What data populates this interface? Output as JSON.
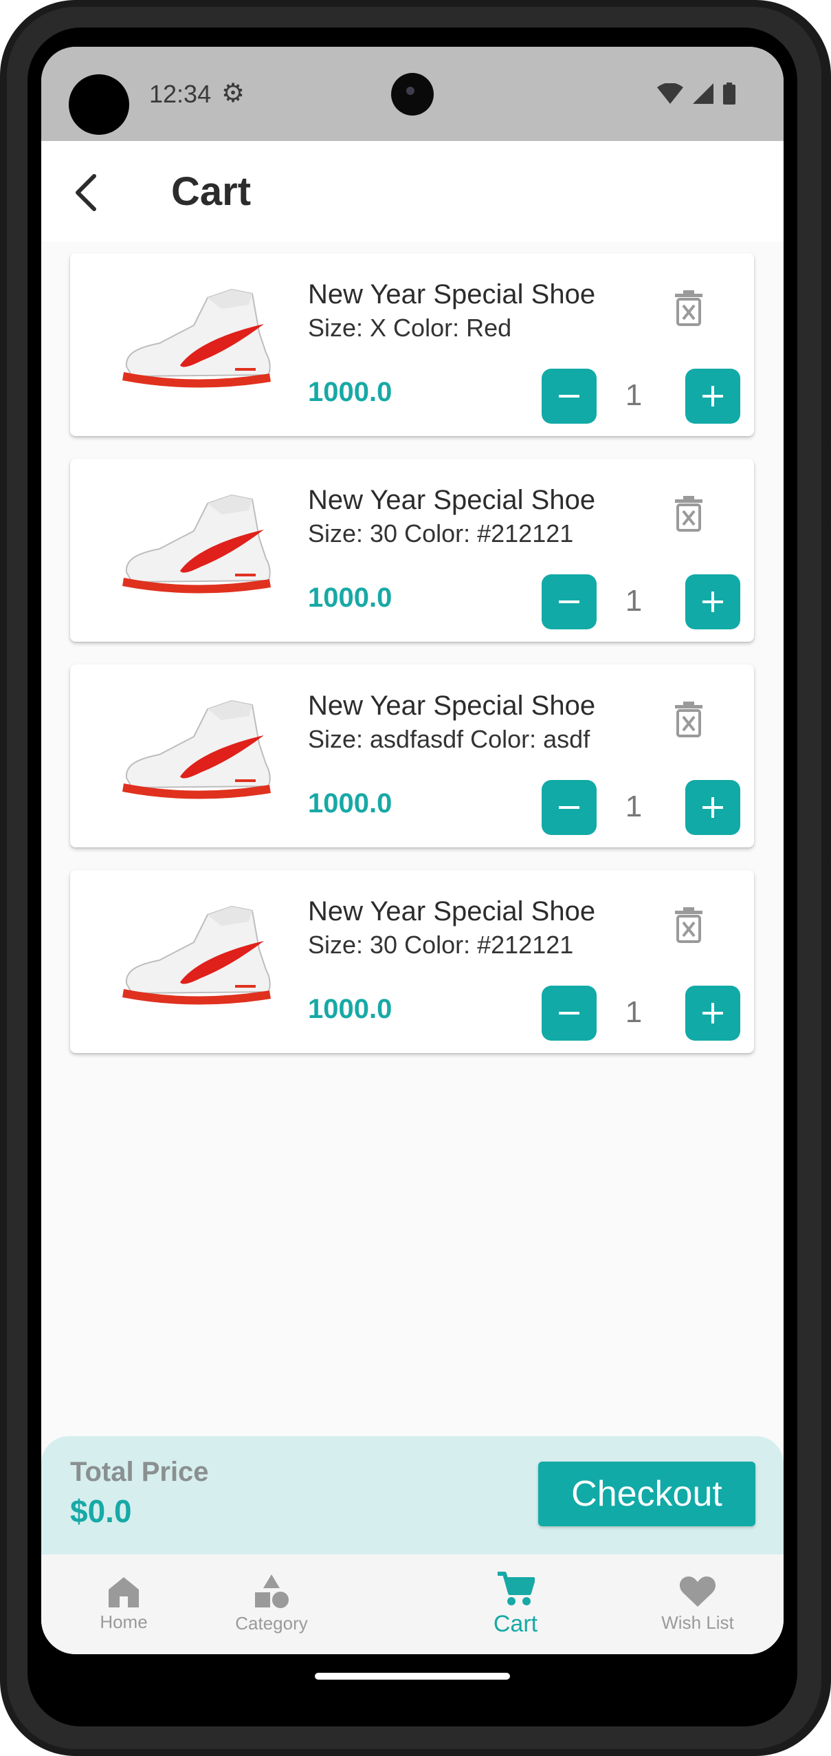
{
  "status_bar": {
    "time": "12:34"
  },
  "header": {
    "title": "Cart",
    "back_icon": "arrow-back-icon"
  },
  "cart_items": [
    {
      "name": "New Year Special Shoe",
      "variant": "Size: X Color: Red",
      "price": "1000.0",
      "quantity": "1"
    },
    {
      "name": "New Year Special Shoe",
      "variant": "Size: 30 Color: #212121",
      "price": "1000.0",
      "quantity": "1"
    },
    {
      "name": "New Year Special Shoe",
      "variant": "Size: asdfasdf Color: asdf",
      "price": "1000.0",
      "quantity": "1"
    },
    {
      "name": "New Year Special Shoe",
      "variant": "Size: 30 Color: #212121",
      "price": "1000.0",
      "quantity": "1"
    }
  ],
  "summary": {
    "total_label": "Total Price",
    "total_value": "$0.0",
    "checkout_label": "Checkout"
  },
  "bottom_nav": {
    "items": [
      {
        "label": "Home",
        "icon": "home-icon"
      },
      {
        "label": "Category",
        "icon": "category-icon"
      },
      {
        "label": "Cart",
        "icon": "cart-icon",
        "active": true
      },
      {
        "label": "Wish List",
        "icon": "heart-icon"
      }
    ]
  },
  "colors": {
    "accent": "#11aaa7",
    "price": "#17a9a6",
    "summary_background": "#d6eeee",
    "status_bar": "#bdbdbd"
  }
}
